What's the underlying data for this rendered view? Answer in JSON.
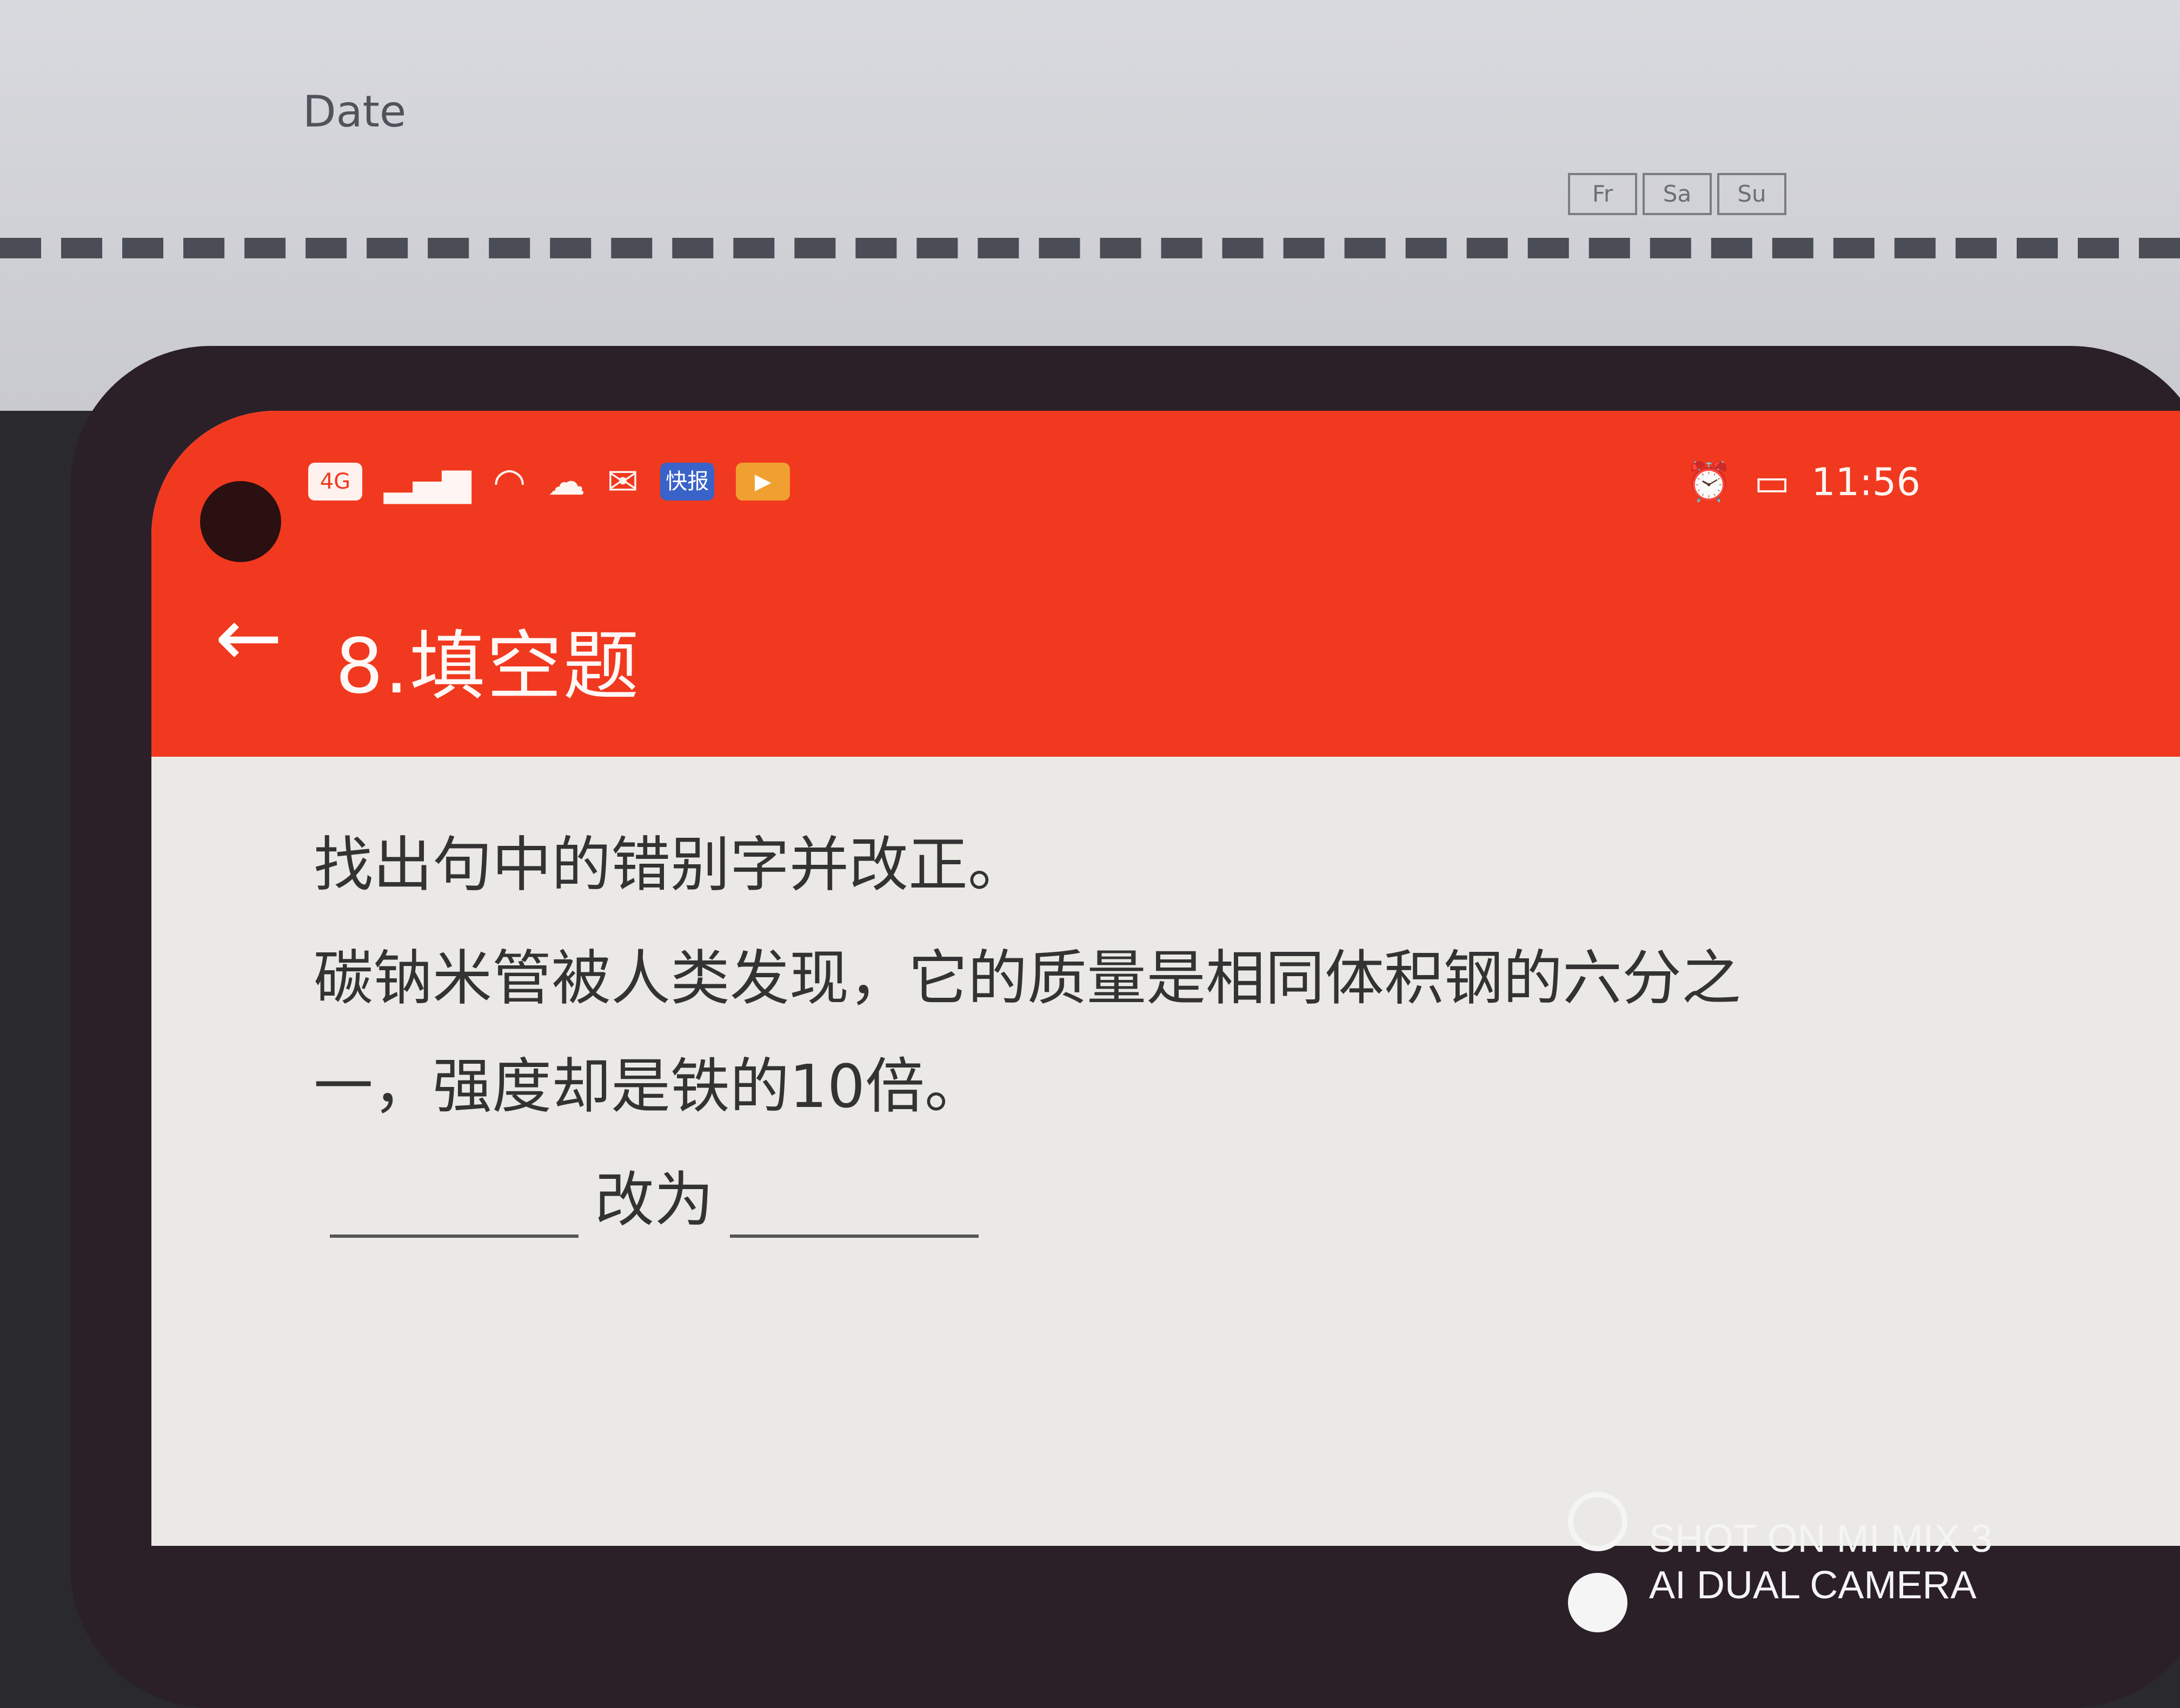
{
  "background": {
    "date_label": "Date",
    "weekdays": [
      "Fr",
      "Sa",
      "Su"
    ]
  },
  "status_bar": {
    "carrier_badge": "4G",
    "news_badge": "快报",
    "time": "11:56",
    "icons": [
      "signal-icon",
      "wifi-icon",
      "cloud-icon",
      "message-icon",
      "play-icon",
      "alarm-icon",
      "battery-icon"
    ]
  },
  "app_bar": {
    "title": "8.填空题",
    "color": "#f1391f"
  },
  "question": {
    "line1": "找出句中的错别字并改正。",
    "line2": "碳钠米管被人类发现，它的质量是相同体积钢的六分之",
    "line3": "一，强度却是铁的10倍。",
    "answer_label": "改为"
  },
  "watermark": {
    "line1": "SHOT ON MI MIX 3",
    "line2": "AI DUAL CAMERA"
  }
}
